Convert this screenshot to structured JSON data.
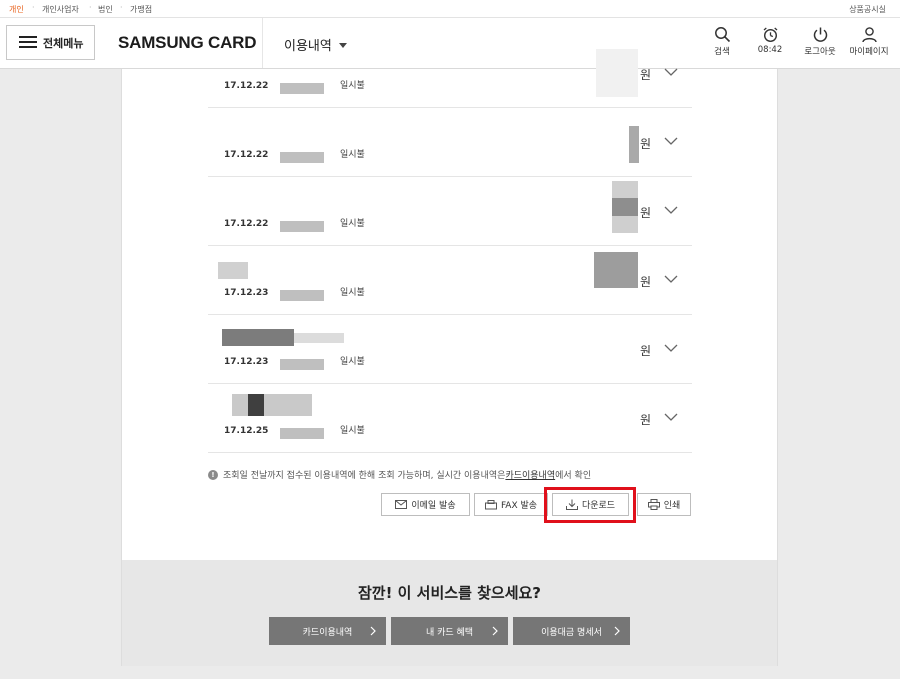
{
  "topbar": {
    "tabs": [
      {
        "label": "개인",
        "active": true
      },
      {
        "label": "개인사업자",
        "active": false
      },
      {
        "label": "법인",
        "active": false
      },
      {
        "label": "가맹점",
        "active": false
      }
    ],
    "right_link": "상품공시실"
  },
  "header": {
    "menu_label": "전체메뉴",
    "logo": "SAMSUNG CARD",
    "nav_title": "이용내역",
    "icons": {
      "search": "검색",
      "timer": "08:42",
      "logout": "로그아웃",
      "mypage": "마이페이지"
    }
  },
  "transactions": [
    {
      "date": "17.12.22",
      "type": "일시불",
      "currency": "원"
    },
    {
      "date": "17.12.22",
      "type": "일시불",
      "currency": "원"
    },
    {
      "date": "17.12.22",
      "type": "일시불",
      "currency": "원"
    },
    {
      "date": "17.12.23",
      "type": "일시불",
      "currency": "원"
    },
    {
      "date": "17.12.23",
      "type": "일시불",
      "currency": "원"
    },
    {
      "date": "17.12.25",
      "type": "일시불",
      "currency": "원"
    }
  ],
  "notice": {
    "before": "조회일 전날까지 접수된 이용내역에 한해 조회 가능하며, 실시간 이용내역은 ",
    "link": "카드이용내역",
    "after": "에서 확인"
  },
  "actions": {
    "email": "이메일 발송",
    "fax": "FAX 발송",
    "download": "다운로드",
    "print": "인쇄"
  },
  "promo": {
    "title": "잠깐! 이 서비스를 찾으세요?",
    "buttons": [
      "카드이용내역",
      "내 카드 혜택",
      "이용대금 명세서"
    ]
  },
  "colors": {
    "accent_orange": "#e8601a",
    "highlight_red": "#e0101b",
    "promo_button": "#767676"
  }
}
